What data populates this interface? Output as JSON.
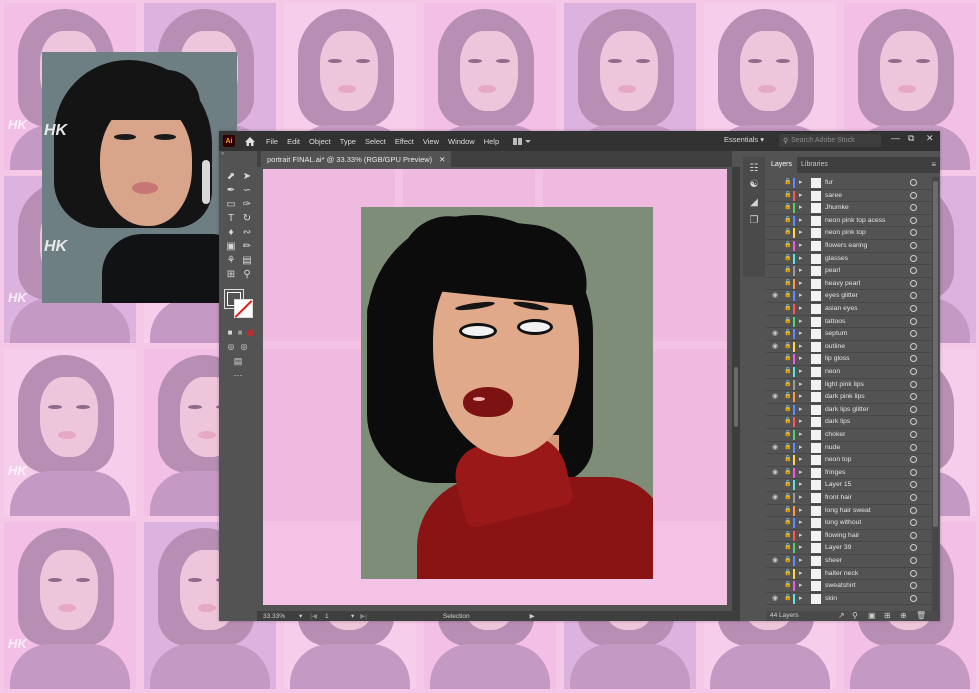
{
  "reference": {
    "watermark": "HK"
  },
  "app": {
    "logo": "Ai",
    "menu": [
      "File",
      "Edit",
      "Object",
      "Type",
      "Select",
      "Effect",
      "View",
      "Window",
      "Help"
    ],
    "workspace": "Essentials",
    "search_placeholder": "Search Adobe Stock",
    "document_tab": "portrait FINAL.ai* @ 33.33% (RGB/GPU Preview)",
    "status": {
      "zoom": "33.33%",
      "page": "1",
      "mode": "Selection"
    }
  },
  "layers_panel": {
    "tabs": [
      "Layers",
      "Libraries"
    ],
    "count_label": "44 Layers",
    "layers": [
      {
        "name": "fur",
        "visible": false,
        "color": "#5a8cff"
      },
      {
        "name": "saree",
        "visible": false,
        "color": "#ff5555"
      },
      {
        "name": "Jhumke",
        "visible": false,
        "color": "#4fd46a"
      },
      {
        "name": "neon pink top acess",
        "visible": false,
        "color": "#5a8cff"
      },
      {
        "name": "neon pink top",
        "visible": false,
        "color": "#ffd84a"
      },
      {
        "name": "flowers earing",
        "visible": false,
        "color": "#e65ce6"
      },
      {
        "name": "glasses",
        "visible": false,
        "color": "#5ae6e6"
      },
      {
        "name": "pearl",
        "visible": false,
        "color": "#9a9a9a"
      },
      {
        "name": "heavy pearl",
        "visible": false,
        "color": "#ff9a3c"
      },
      {
        "name": "eyes glitter",
        "visible": true,
        "color": "#5a8cff"
      },
      {
        "name": "asian eyes",
        "visible": false,
        "color": "#ff5555"
      },
      {
        "name": "tattoos",
        "visible": false,
        "color": "#4fd46a"
      },
      {
        "name": "septum",
        "visible": true,
        "color": "#5a8cff"
      },
      {
        "name": "outline",
        "visible": true,
        "color": "#ffd84a"
      },
      {
        "name": "lip gloss",
        "visible": false,
        "color": "#e65ce6"
      },
      {
        "name": "neon",
        "visible": false,
        "color": "#5ae6e6"
      },
      {
        "name": "light pink lips",
        "visible": false,
        "color": "#9a9a9a"
      },
      {
        "name": "dark pink lips",
        "visible": true,
        "color": "#ff9a3c"
      },
      {
        "name": "dark lips glitter",
        "visible": false,
        "color": "#5a8cff"
      },
      {
        "name": "dark lips",
        "visible": false,
        "color": "#ff5555"
      },
      {
        "name": "choker",
        "visible": false,
        "color": "#4fd46a"
      },
      {
        "name": "nude",
        "visible": true,
        "color": "#5a8cff"
      },
      {
        "name": "neon top",
        "visible": false,
        "color": "#ffd84a"
      },
      {
        "name": "fringes",
        "visible": true,
        "color": "#e65ce6"
      },
      {
        "name": "Layer 15",
        "visible": false,
        "color": "#5ae6e6"
      },
      {
        "name": "front hair",
        "visible": true,
        "color": "#9a9a9a"
      },
      {
        "name": "long hair sweat",
        "visible": false,
        "color": "#ff9a3c"
      },
      {
        "name": "long without",
        "visible": false,
        "color": "#5a8cff"
      },
      {
        "name": "flowing hair",
        "visible": false,
        "color": "#ff5555"
      },
      {
        "name": "Layer 39",
        "visible": false,
        "color": "#4fd46a"
      },
      {
        "name": "sheer",
        "visible": true,
        "color": "#5a8cff"
      },
      {
        "name": "halter neck",
        "visible": false,
        "color": "#ffd84a"
      },
      {
        "name": "sweatshirt",
        "visible": false,
        "color": "#e65ce6"
      },
      {
        "name": "skin",
        "visible": true,
        "color": "#5ae6e6"
      }
    ]
  }
}
